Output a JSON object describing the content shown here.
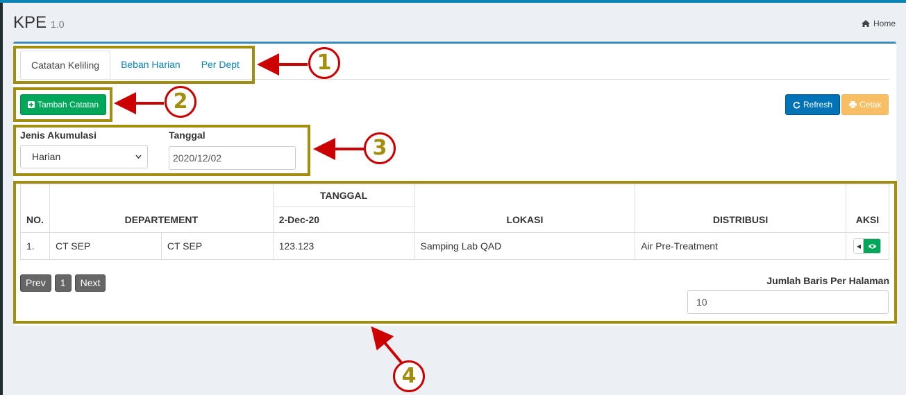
{
  "header": {
    "title": "KPE",
    "version": "1.0",
    "breadcrumb_home": "Home"
  },
  "tabs": [
    {
      "label": "Catatan Keliling",
      "active": true
    },
    {
      "label": "Beban Harian",
      "active": false
    },
    {
      "label": "Per Dept",
      "active": false
    }
  ],
  "toolbar": {
    "add_label": "Tambah Catatan",
    "refresh_label": "Refresh",
    "print_label": "Cetak"
  },
  "filters": {
    "accumulation_label": "Jenis Akumulasi",
    "accumulation_value": "Harian",
    "date_label": "Tanggal",
    "date_value": "2020/12/02"
  },
  "table": {
    "headers": {
      "no": "NO.",
      "department": "DEPARTEMENT",
      "date_group": "TANGGAL",
      "date": "2-Dec-20",
      "location": "LOKASI",
      "distribution": "DISTRIBUSI",
      "action": "AKSI"
    },
    "rows": [
      {
        "no": "1.",
        "dept_a": "CT SEP",
        "dept_b": "CT SEP",
        "value": "123.123",
        "location": "Samping Lab QAD",
        "distribution": "Air Pre-Treatment"
      }
    ]
  },
  "pagination": {
    "prev": "Prev",
    "page": "1",
    "next": "Next"
  },
  "rows_per_page": {
    "label": "Jumlah Baris Per Halaman",
    "value": "10"
  },
  "annotations": [
    "1",
    "2",
    "3",
    "4"
  ],
  "colors": {
    "accent": "#3c8dbc",
    "success": "#00a65a",
    "primary": "#0073b7",
    "warning": "#f39c12",
    "marker": "#a38d0e",
    "arrow": "#cc0000"
  }
}
